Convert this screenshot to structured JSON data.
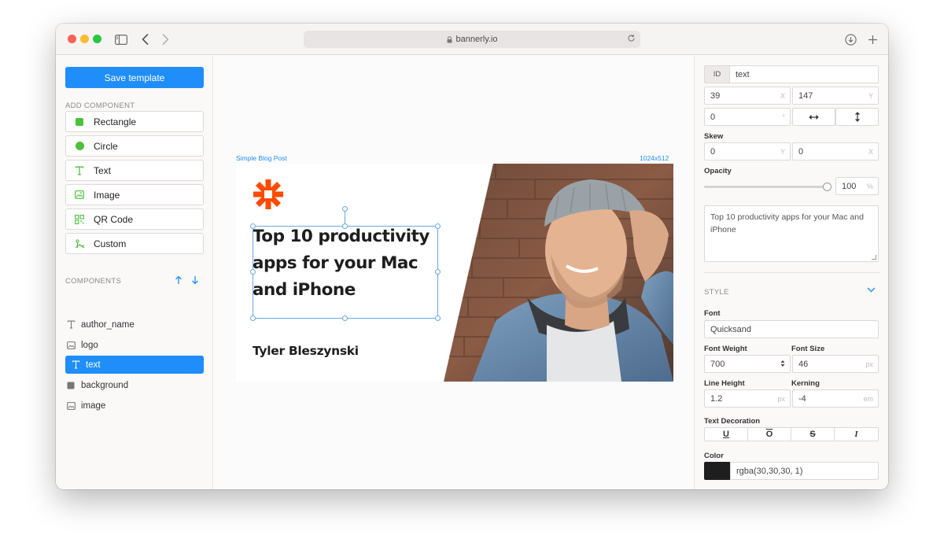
{
  "browser": {
    "url": "bannerly.io"
  },
  "sidebar": {
    "save_label": "Save template",
    "add_component_label": "ADD COMPONENT",
    "add_items": [
      {
        "label": "Rectangle",
        "icon": "square-icon"
      },
      {
        "label": "Circle",
        "icon": "circle-icon"
      },
      {
        "label": "Text",
        "icon": "text-icon"
      },
      {
        "label": "Image",
        "icon": "image-icon"
      },
      {
        "label": "QR Code",
        "icon": "qr-code-icon"
      },
      {
        "label": "Custom",
        "icon": "custom-icon"
      }
    ],
    "components_label": "COMPONENTS",
    "components": [
      {
        "label": "author_name",
        "icon": "text-icon",
        "active": false
      },
      {
        "label": "logo",
        "icon": "image-icon",
        "active": false
      },
      {
        "label": "text",
        "icon": "text-icon",
        "active": true
      },
      {
        "label": "background",
        "icon": "square-icon",
        "active": false
      },
      {
        "label": "image",
        "icon": "image-icon",
        "active": false
      }
    ]
  },
  "canvas": {
    "template_name": "Simple Blog Post",
    "size": "1024x512",
    "headline": "Top 10 productivity apps for your Mac and iPhone",
    "author": "Tyler Bleszynski"
  },
  "panel": {
    "id_label": "ID",
    "id_value": "text",
    "x_value": "39",
    "x_unit": "X",
    "y_value": "147",
    "y_unit": "Y",
    "rotation_value": "0",
    "rotation_unit": "°",
    "skew_label": "Skew",
    "skew_y_value": "0",
    "skew_y_unit": "Y",
    "skew_x_value": "0",
    "skew_x_unit": "X",
    "opacity_label": "Opacity",
    "opacity_value": "100",
    "opacity_unit": "%",
    "opacity_fraction": 1.0,
    "text_content": "Top 10 productivity apps for your Mac and iPhone",
    "style_label": "STYLE",
    "font_label": "Font",
    "font_value": "Quicksand",
    "font_weight_label": "Font Weight",
    "font_weight_value": "700",
    "font_size_label": "Font Size",
    "font_size_value": "46",
    "font_size_unit": "px",
    "line_height_label": "Line Height",
    "line_height_value": "1.2",
    "line_height_unit": "px",
    "kerning_label": "Kerning",
    "kerning_value": "-4",
    "kerning_unit": "em",
    "text_decoration_label": "Text Decoration",
    "decorations": [
      "U",
      "O",
      "S",
      "I"
    ],
    "color_label": "Color",
    "color_value": "rgba(30,30,30, 1)",
    "accent_color": "#1f8efa"
  }
}
